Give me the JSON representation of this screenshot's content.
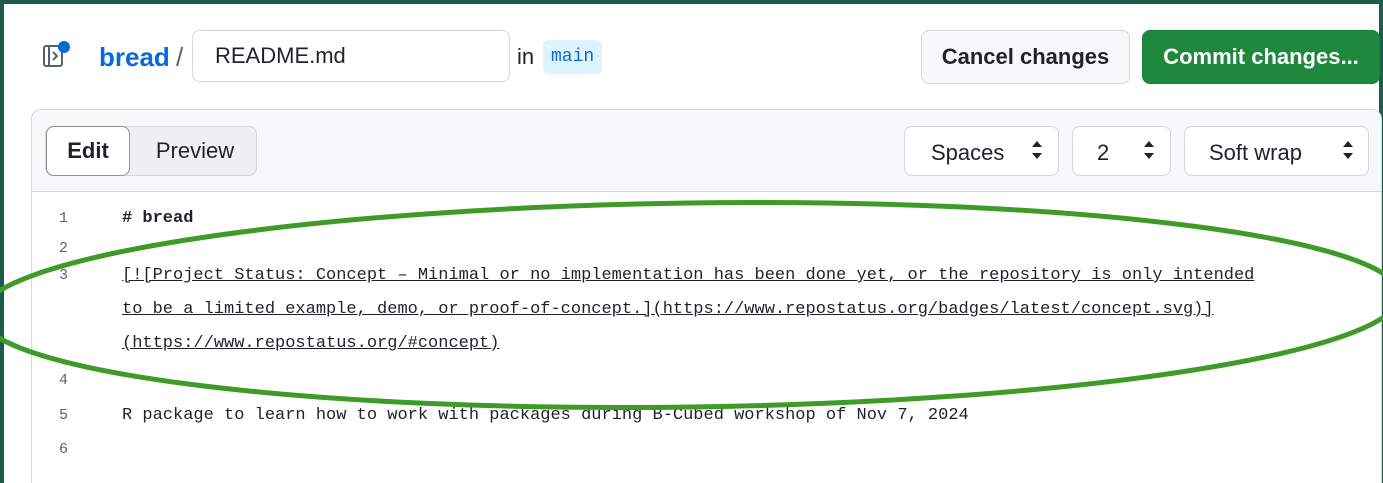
{
  "header": {
    "repo_name": "bread",
    "path_separator": "/",
    "filename_value": "README.md",
    "in_label": "in",
    "branch": "main",
    "cancel_label": "Cancel changes",
    "commit_label": "Commit changes..."
  },
  "toolbar": {
    "edit_tab": "Edit",
    "preview_tab": "Preview",
    "indent_mode": "Spaces",
    "indent_size": "2",
    "wrap_mode": "Soft wrap"
  },
  "lines": [
    {
      "number": "1",
      "text": "# bread"
    },
    {
      "number": "2",
      "text": ""
    },
    {
      "number": "3",
      "text_a": "[![Project Status: Concept – Minimal or no implementation has been done yet, or the repository is only intended",
      "text_b": "to be a limited example, demo, or proof-of-concept.](https://www.repostatus.org/badges/latest/concept.svg)]",
      "text_c": "(https://www.repostatus.org/#concept)"
    },
    {
      "number": "4",
      "text": ""
    },
    {
      "number": "5",
      "text": "R package to learn how to work with packages during B-Cubed workshop of Nov 7, 2024"
    },
    {
      "number": "6",
      "text": ""
    }
  ],
  "colors": {
    "frame_border": "#1d5b4c",
    "accent_blue": "#0969da",
    "commit_green": "#1f883d",
    "highlight_oval": "#3f9b27"
  },
  "icons": [
    "repo-icon",
    "select-caret-icon"
  ]
}
